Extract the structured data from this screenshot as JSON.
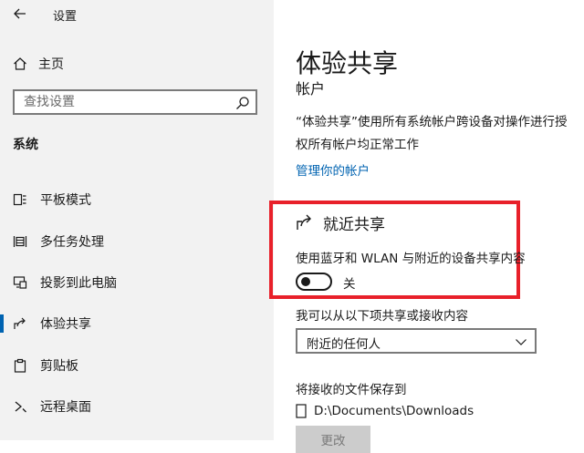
{
  "app": {
    "title": "设置"
  },
  "sidebar": {
    "home_label": "主页",
    "search_placeholder": "查找设置",
    "section": "系统",
    "items": [
      {
        "label": "平板模式",
        "icon": "tablet-mode-icon"
      },
      {
        "label": "多任务处理",
        "icon": "multitasking-icon"
      },
      {
        "label": "投影到此电脑",
        "icon": "project-to-pc-icon"
      },
      {
        "label": "体验共享",
        "icon": "shared-experiences-icon",
        "selected": true
      },
      {
        "label": "剪贴板",
        "icon": "clipboard-icon"
      },
      {
        "label": "远程桌面",
        "icon": "remote-desktop-icon"
      }
    ]
  },
  "main": {
    "title": "体验共享",
    "accounts_heading": "帐户",
    "accounts_desc": "“体验共享”使用所有系统帐户跨设备对操作进行授权所有帐户均正常工作",
    "manage_link": "管理你的帐户",
    "nearby": {
      "title": "就近共享",
      "desc": "使用蓝牙和 WLAN 与附近的设备共享内容",
      "toggle_state": "关",
      "toggle_on": false
    },
    "share_from_label": "我可以从以下项共享或接收内容",
    "share_from_value": "附近的任何人",
    "save_to_label": "将接收的文件保存到",
    "save_path": "D:\\Documents\\Downloads",
    "change_button": "更改"
  },
  "colors": {
    "accent": "#0063b1",
    "highlight": "#e8202a",
    "sidebar_bg": "#f2f2f2"
  }
}
